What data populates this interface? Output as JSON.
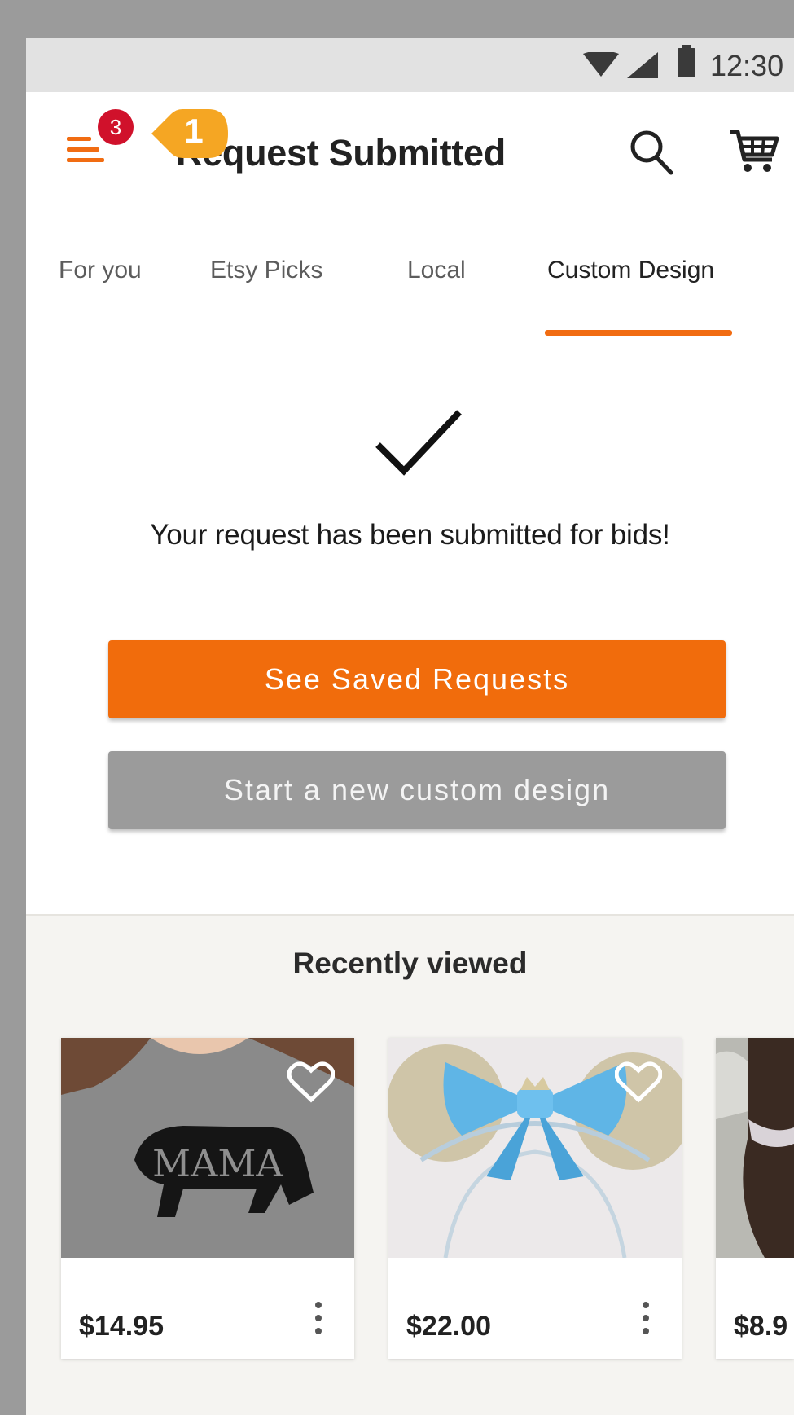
{
  "status_bar": {
    "time": "12:30",
    "icons": [
      "wifi-icon",
      "signal-icon",
      "battery-icon"
    ]
  },
  "app_bar": {
    "title": "Request Submitted",
    "menu_badge": "3",
    "coachmark": "1",
    "icons": [
      "menu-icon",
      "search-icon",
      "cart-icon"
    ]
  },
  "tabs": [
    {
      "label": "For you",
      "active": false
    },
    {
      "label": "Etsy Picks",
      "active": false
    },
    {
      "label": "Local",
      "active": false
    },
    {
      "label": "Custom Design",
      "active": true
    }
  ],
  "confirmation": {
    "icon": "checkmark-icon",
    "message": "Your request has been submitted for bids!",
    "primary_button": "See Saved Requests",
    "secondary_button": "Start a new custom design"
  },
  "recently_viewed": {
    "title": "Recently viewed",
    "items": [
      {
        "price": "$14.95",
        "image": "mama-bear-tshirt"
      },
      {
        "price": "$22.00",
        "image": "mouse-ears-headband"
      },
      {
        "price": "$8.9",
        "image": "headband-photo"
      }
    ]
  },
  "colors": {
    "accent": "#f16c0c",
    "badge": "#d0112b",
    "coachmark": "#f5a623",
    "secondary_button": "#9b9b9b"
  }
}
